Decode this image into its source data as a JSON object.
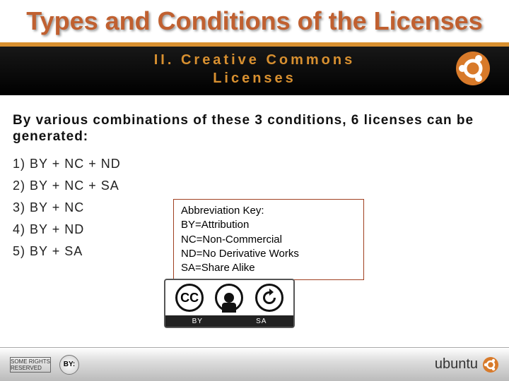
{
  "title": "Types and Conditions of the Licenses",
  "header": {
    "line1": "II. Creative Commons",
    "line2": "Licenses"
  },
  "intro": "By various combinations of these 3 conditions, 6 licenses can be generated:",
  "list": [
    "1) BY + NC + ND",
    "2) BY + NC + SA",
    "3) BY + NC",
    "4) BY + ND",
    "5) BY + SA"
  ],
  "key": {
    "heading": "Abbreviation Key:",
    "lines": [
      "BY=Attribution",
      "NC=Non-Commercial",
      "ND=No Derivative Works",
      "SA=Share Alike"
    ]
  },
  "badge": {
    "cc_label": "CC",
    "by_label": "BY",
    "sa_label": "SA"
  },
  "footer": {
    "rights_text": "SOME RIGHTS RESERVED",
    "by_text": "BY:",
    "brand": "ubuntu"
  }
}
